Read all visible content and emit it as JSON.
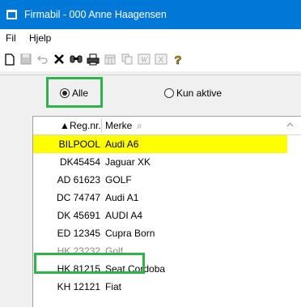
{
  "window": {
    "title": "Firmabil - 000 Anne Haagensen"
  },
  "menu": {
    "items": [
      "Fil",
      "Hjelp"
    ]
  },
  "toolbar": {
    "icons": [
      "new-icon",
      "save-icon",
      "undo-icon",
      "delete-icon",
      "find-icon",
      "print-icon",
      "calendar-icon",
      "copy-icon",
      "word-icon",
      "excel-icon",
      "help-icon"
    ]
  },
  "filter": {
    "options": [
      {
        "label": "Alle",
        "checked": true
      },
      {
        "label": "Kun aktive",
        "checked": false
      }
    ]
  },
  "table": {
    "columns": [
      {
        "label": "Reg.nr.",
        "sort_icon": "▲"
      },
      {
        "label": "Merke",
        "filter_icon": "⌕"
      }
    ],
    "rows": [
      {
        "reg": "BILPOOL",
        "merke": "Audi A6",
        "selected": true
      },
      {
        "reg": "DK45454",
        "merke": "Jaguar XK"
      },
      {
        "reg": "AD 61623",
        "merke": "GOLF"
      },
      {
        "reg": "DC 74747",
        "merke": "Audi A1"
      },
      {
        "reg": "DK 45691",
        "merke": "AUDI A4"
      },
      {
        "reg": "ED 12345",
        "merke": "Cupra Born"
      },
      {
        "reg": "HK 23232",
        "merke": "Golf",
        "inactive": true
      },
      {
        "reg": "HK 81215",
        "merke": "Seat Cordoba"
      },
      {
        "reg": "KH 12121",
        "merke": "Fiat"
      }
    ]
  },
  "colors": {
    "titlebar": "#0078d7",
    "selected_row": "#ffff00",
    "highlight": "#2db34a"
  }
}
